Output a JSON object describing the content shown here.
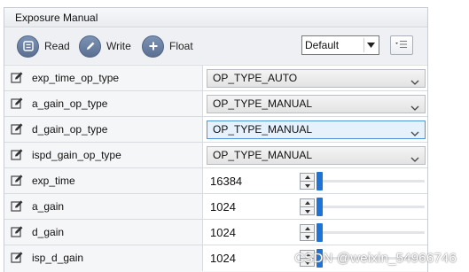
{
  "panel": {
    "title": "Exposure Manual"
  },
  "toolbar": {
    "read_label": "Read",
    "write_label": "Write",
    "float_label": "Float",
    "preset": {
      "selected": "Default"
    }
  },
  "rows": [
    {
      "name": "exp_time_op_type",
      "kind": "combo",
      "value": "OP_TYPE_AUTO",
      "active": false
    },
    {
      "name": "a_gain_op_type",
      "kind": "combo",
      "value": "OP_TYPE_MANUAL",
      "active": false
    },
    {
      "name": "d_gain_op_type",
      "kind": "combo",
      "value": "OP_TYPE_MANUAL",
      "active": true
    },
    {
      "name": "ispd_gain_op_type",
      "kind": "combo",
      "value": "OP_TYPE_MANUAL",
      "active": false
    },
    {
      "name": "exp_time",
      "kind": "number",
      "value": "16384",
      "slider_fraction": 0
    },
    {
      "name": "a_gain",
      "kind": "number",
      "value": "1024",
      "slider_fraction": 0
    },
    {
      "name": "d_gain",
      "kind": "number",
      "value": "1024",
      "slider_fraction": 0
    },
    {
      "name": "isp_d_gain",
      "kind": "number",
      "value": "1024",
      "slider_fraction": 0
    }
  ],
  "watermark": "CSDN @weixin_54966746",
  "icons": {
    "read": "read-icon",
    "write": "pencil-icon",
    "float": "plus-icon",
    "list": "list-menu-icon",
    "edit": "edit-icon"
  },
  "colors": {
    "toolbar_icon": "#6a7fa2",
    "slider_thumb": "#1f72d6",
    "active_combo_border": "#4d95d6",
    "active_combo_bg": "#e6f1fb"
  }
}
